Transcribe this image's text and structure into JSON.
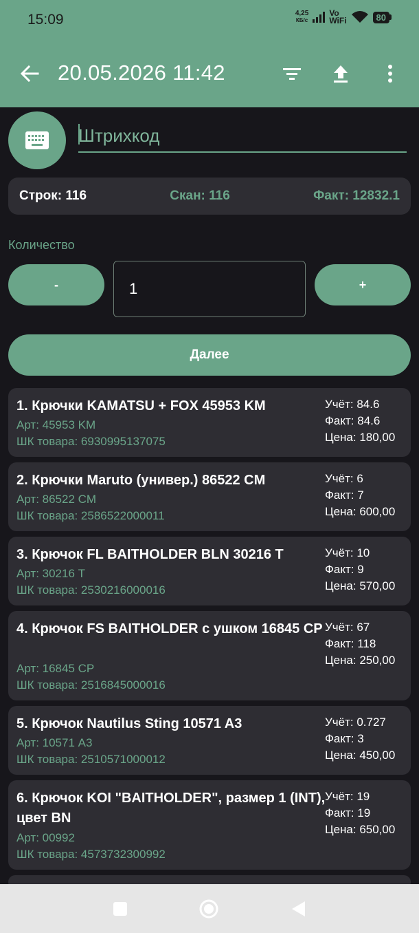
{
  "status_bar": {
    "time": "15:09",
    "net_speed_top": "4,25",
    "net_speed_bottom": "КБ/с",
    "vo_top": "Vo",
    "vo_bottom": "WiFi",
    "battery": "80"
  },
  "header": {
    "title": "20.05.2026 11:42",
    "icons": [
      "back-arrow-icon",
      "filter-icon",
      "upload-icon",
      "more-vert-icon"
    ]
  },
  "barcode": {
    "placeholder": "Штрихкод",
    "value": ""
  },
  "stats": {
    "rows": "Строк: 116",
    "scan": "Скан: 116",
    "fact": "Факт: 12832.1"
  },
  "quantity": {
    "label": "Количество",
    "minus": "-",
    "value": "1",
    "plus": "+"
  },
  "next_label": "Далее",
  "items": [
    {
      "name": "1. Крючки KAMATSU + FOX 45953 KM",
      "art": "Арт: 45953 KM",
      "barcode": "ШК товара: 6930995137075",
      "account": "Учёт: 84.6",
      "fact": "Факт: 84.6",
      "price": "Цена: 180,00"
    },
    {
      "name": "2. Крючки Maruto (универ.) 86522 CM",
      "art": "Арт: 86522 CM",
      "barcode": "ШК товара: 2586522000011",
      "account": "Учёт: 6",
      "fact": "Факт: 7",
      "price": "Цена: 600,00"
    },
    {
      "name": "3. Крючок FL BAITHOLDER BLN 30216 T",
      "art": "Арт: 30216 T",
      "barcode": "ШК товара: 2530216000016",
      "account": "Учёт: 10",
      "fact": "Факт: 9",
      "price": "Цена: 570,00"
    },
    {
      "name": "4. Крючок FS BAITHOLDER  с ушком  16845 CP",
      "art": "Арт: 16845 CP",
      "barcode": "ШК товара: 2516845000016",
      "account": "Учёт: 67",
      "fact": "Факт: 118",
      "price": "Цена: 250,00"
    },
    {
      "name": "5. Крючок Nautilus Sting  10571 A3",
      "art": "Арт: 10571 A3",
      "barcode": "ШК товара: 2510571000012",
      "account": "Учёт: 0.727",
      "fact": "Факт: 3",
      "price": "Цена: 450,00"
    },
    {
      "name": "6. Крючок KOI \"BAITHOLDER\", размер 1 (INT), цвет BN",
      "art": "Арт: 00992",
      "barcode": "ШК товара: 4573732300992",
      "account": "Учёт: 19",
      "fact": "Факт: 19",
      "price": "Цена: 650,00"
    }
  ],
  "colors": {
    "accent": "#6aa589",
    "background": "#17161b",
    "card": "#2e2d33",
    "navbar": "#e6e6e6"
  }
}
